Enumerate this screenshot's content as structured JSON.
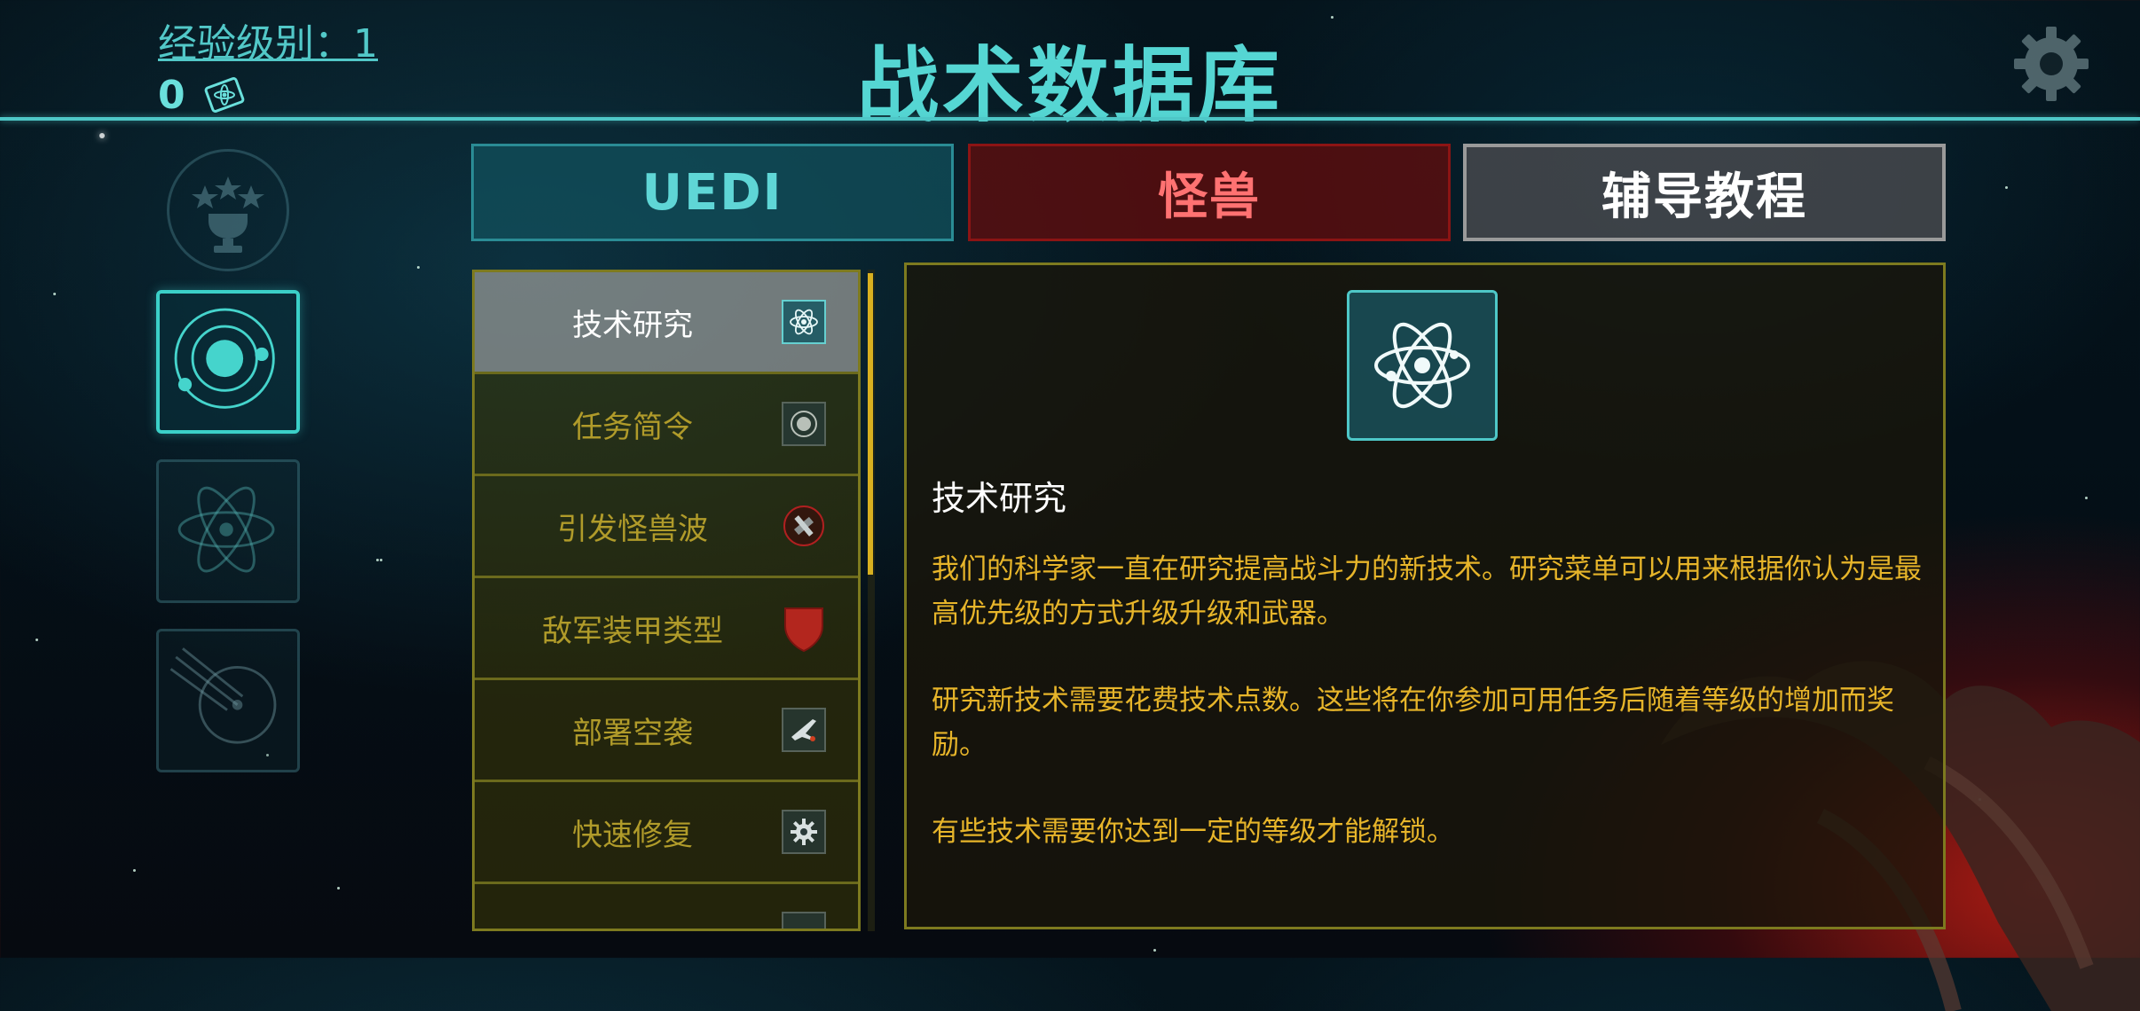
{
  "header": {
    "title": "战术数据库",
    "xp_label": "经验级别：1",
    "xp_points": "0"
  },
  "tabs": [
    {
      "label": "UEDI",
      "color": "#5fd6d6"
    },
    {
      "label": "怪兽",
      "color": "#ff7272"
    },
    {
      "label": "辅导教程",
      "color": "#ffffff"
    }
  ],
  "list": {
    "items": [
      {
        "label": "技术研究",
        "icon": "atom-icon",
        "selected": true
      },
      {
        "label": "任务简令",
        "icon": "radar-icon",
        "selected": false
      },
      {
        "label": "引发怪兽波",
        "icon": "satellite-icon",
        "selected": false
      },
      {
        "label": "敌军装甲类型",
        "icon": "shield-icon",
        "selected": false
      },
      {
        "label": "部署空袭",
        "icon": "jet-icon",
        "selected": false
      },
      {
        "label": "快速修复",
        "icon": "gear-icon",
        "selected": false
      }
    ]
  },
  "detail": {
    "title": "技术研究",
    "icon": "atom-icon",
    "paragraphs": [
      "我们的科学家一直在研究提高战斗力的新技术。研究菜单可以用来根据你认为是最高优先级的方式升级升级和武器。",
      "研究新技术需要花费技术点数。这些将在你参加可用任务后随着等级的增加而奖励。",
      "有些技术需要你达到一定的等级才能解锁。"
    ]
  },
  "colors": {
    "accent": "#4ec7c7",
    "list_text": "#b09b2a",
    "detail_text": "#e7b52a"
  }
}
